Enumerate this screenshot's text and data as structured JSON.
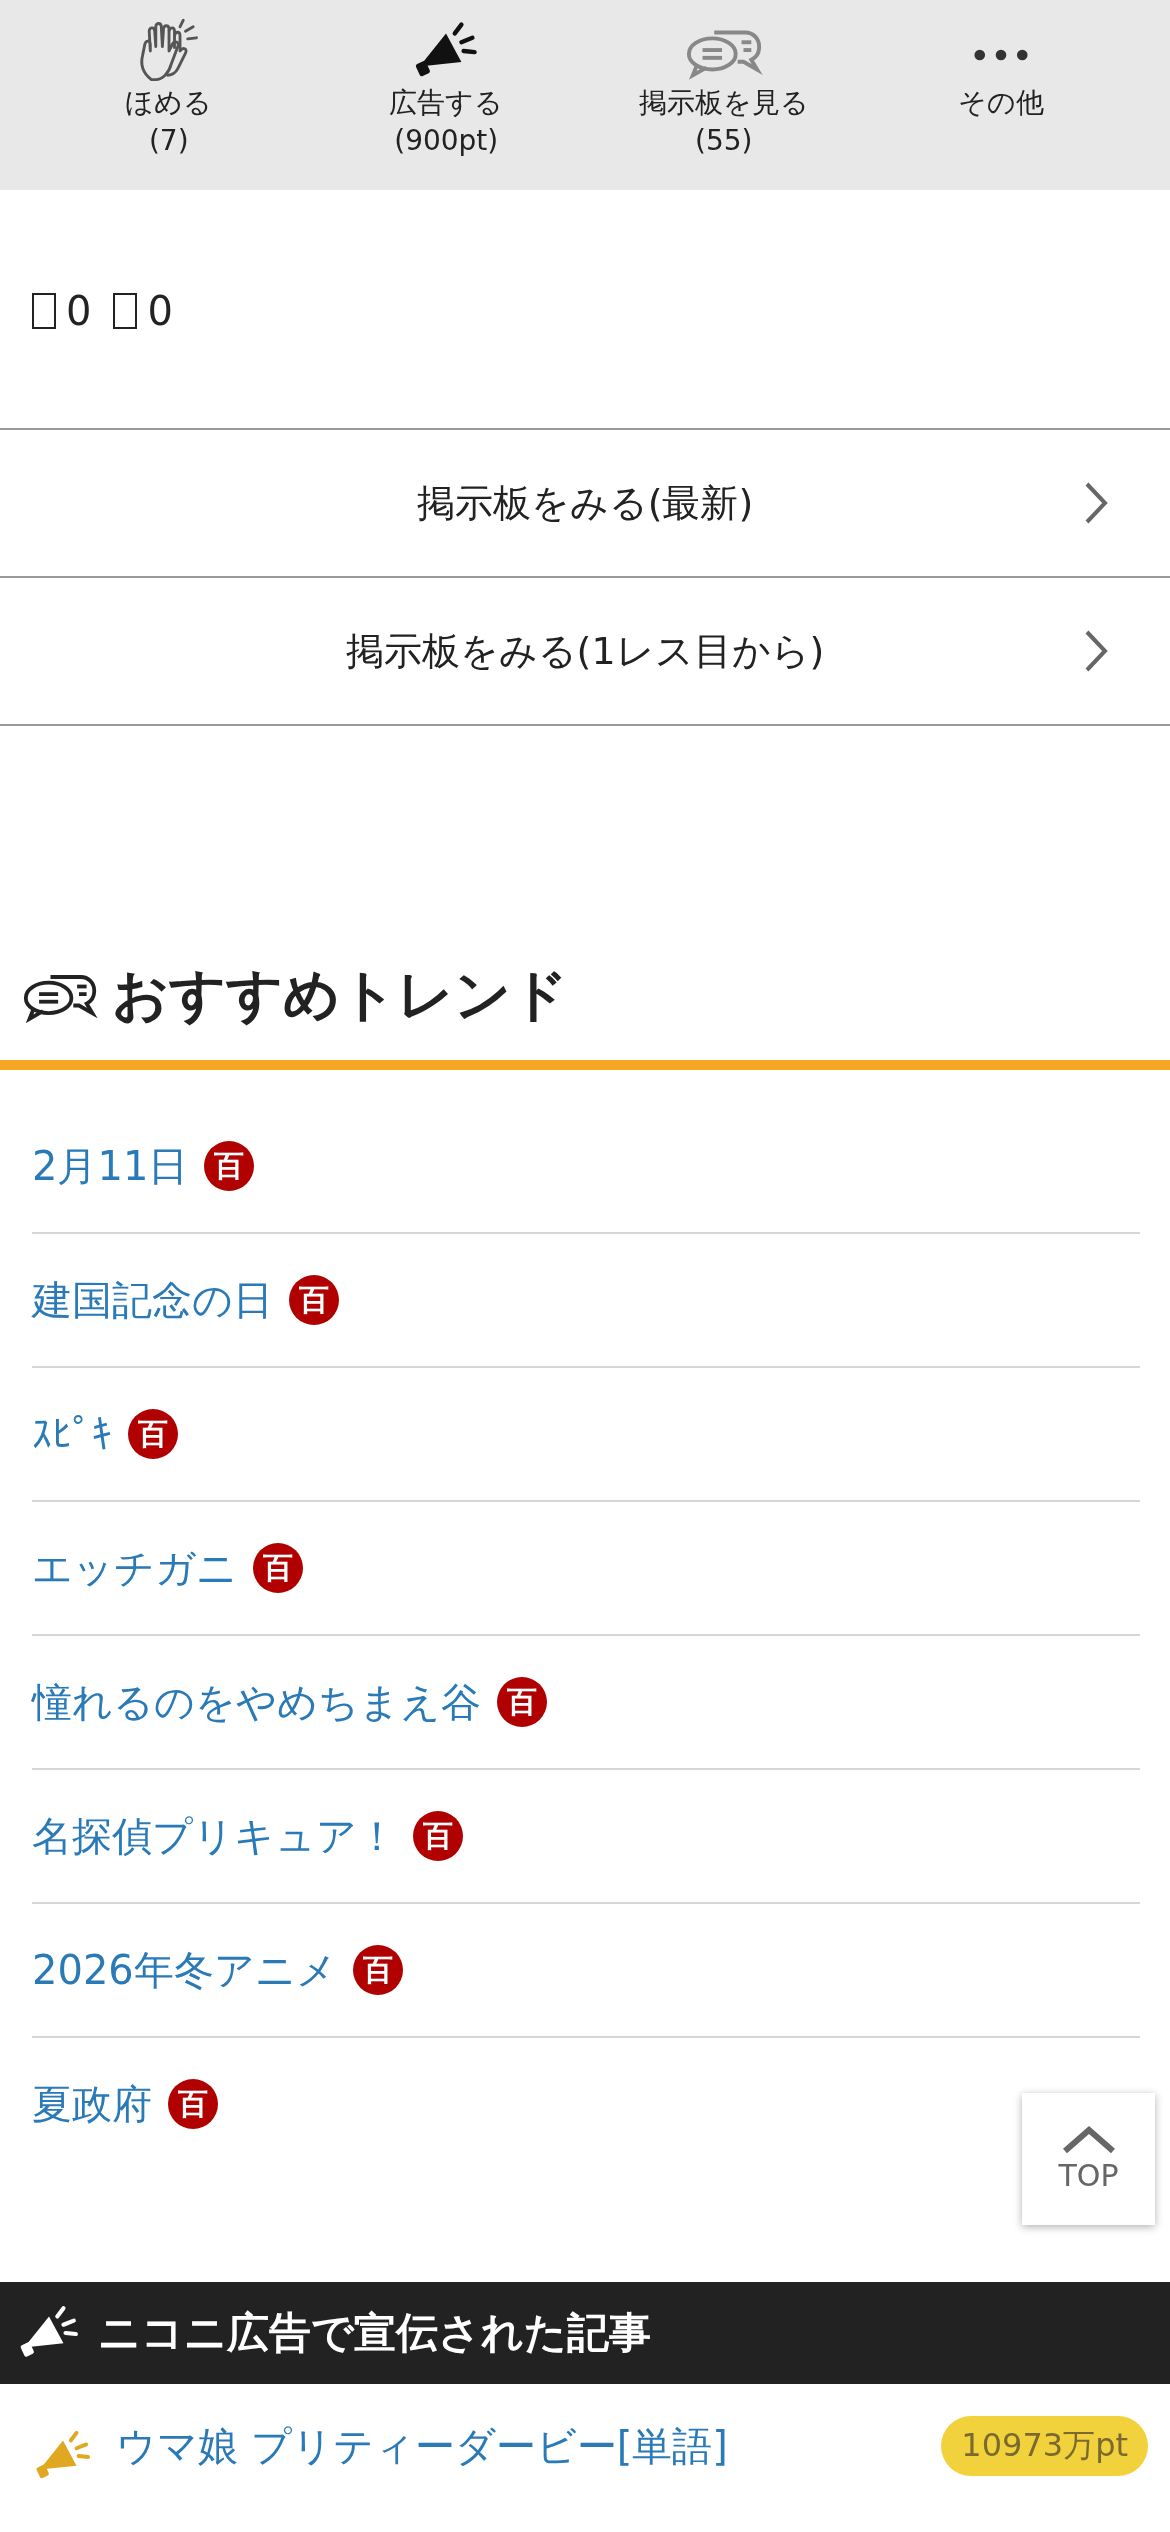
{
  "action_bar": [
    {
      "kind": "clap",
      "label": "ほめる",
      "count": "(7)"
    },
    {
      "kind": "megaphone",
      "label": "広告する",
      "count": "(900pt)"
    },
    {
      "kind": "chat",
      "label": "掲示板を見る",
      "count": "(55)"
    },
    {
      "kind": "more",
      "label": "その他"
    }
  ],
  "reactions": [
    {
      "count": "0"
    },
    {
      "count": "0"
    }
  ],
  "board_links": [
    {
      "label": "掲示板をみる(最新)"
    },
    {
      "label": "掲示板をみる(1レス目から)"
    }
  ],
  "trends": {
    "title": "おすすめトレンド",
    "items": [
      {
        "label": "2月11日",
        "badge": "百"
      },
      {
        "label": "建国記念の日",
        "badge": "百"
      },
      {
        "label": "ｽﾋﾟｷ",
        "badge": "百"
      },
      {
        "label": "エッチガニ",
        "badge": "百"
      },
      {
        "label": "憧れるのをやめちまえ谷",
        "badge": "百"
      },
      {
        "label": "名探偵プリキュア！",
        "badge": "百"
      },
      {
        "label": "2026年冬アニメ",
        "badge": "百"
      },
      {
        "label": "夏政府",
        "badge": "百"
      }
    ]
  },
  "top_button": {
    "label": "TOP"
  },
  "promoted": {
    "title": "ニコニ広告で宣伝された記事",
    "items": [
      {
        "label": "ウマ娘 プリティーダービー[単語]",
        "points": "10973万pt"
      }
    ]
  }
}
